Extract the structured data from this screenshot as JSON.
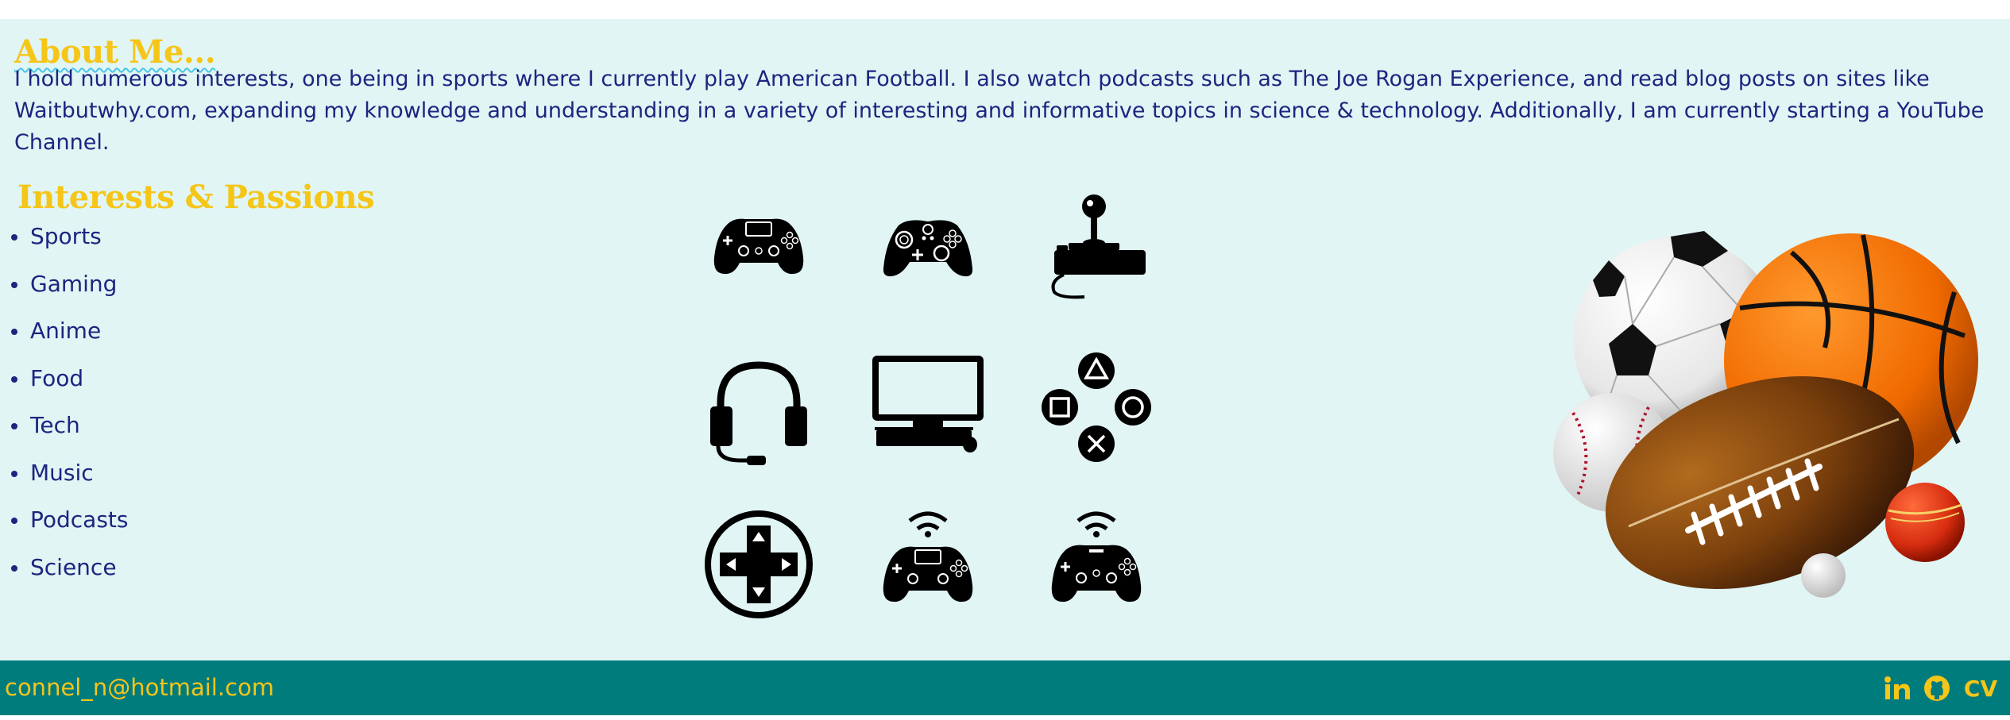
{
  "about": {
    "title": "About Me...",
    "text": "I hold numerous interests, one being in sports where I currently play American Football. I also watch podcasts such as The Joe Rogan Experience, and read blog posts on sites like Waitbutwhy.com, expanding my knowledge and understanding in a variety of interesting and informative topics in science & technology. Additionally, I am currently starting a YouTube Channel."
  },
  "interests": {
    "title": "Interests & Passions",
    "items": [
      "Sports",
      "Gaming",
      "Anime",
      "Food",
      "Tech",
      "Music",
      "Podcasts",
      "Science"
    ]
  },
  "gaming_icons": [
    "playstation-controller-icon",
    "xbox-controller-icon",
    "joystick-icon",
    "headset-icon",
    "computer-icon",
    "playstation-buttons-icon",
    "dpad-icon",
    "wireless-controller-icon",
    "wireless-sony-controller-icon"
  ],
  "sports_image": "sports-balls-image",
  "footer": {
    "email": "connel_n@hotmail.com",
    "social": [
      {
        "name": "linkedin-icon",
        "label": "in"
      },
      {
        "name": "github-icon"
      },
      {
        "name": "cv-link",
        "label": "CV"
      }
    ]
  },
  "colors": {
    "accent_yellow": "#f5c518",
    "text_navy": "#1d2580",
    "section_bg": "#e0f5f4",
    "footer_bg": "#017c7d",
    "underline_blue": "#46c6e8"
  }
}
